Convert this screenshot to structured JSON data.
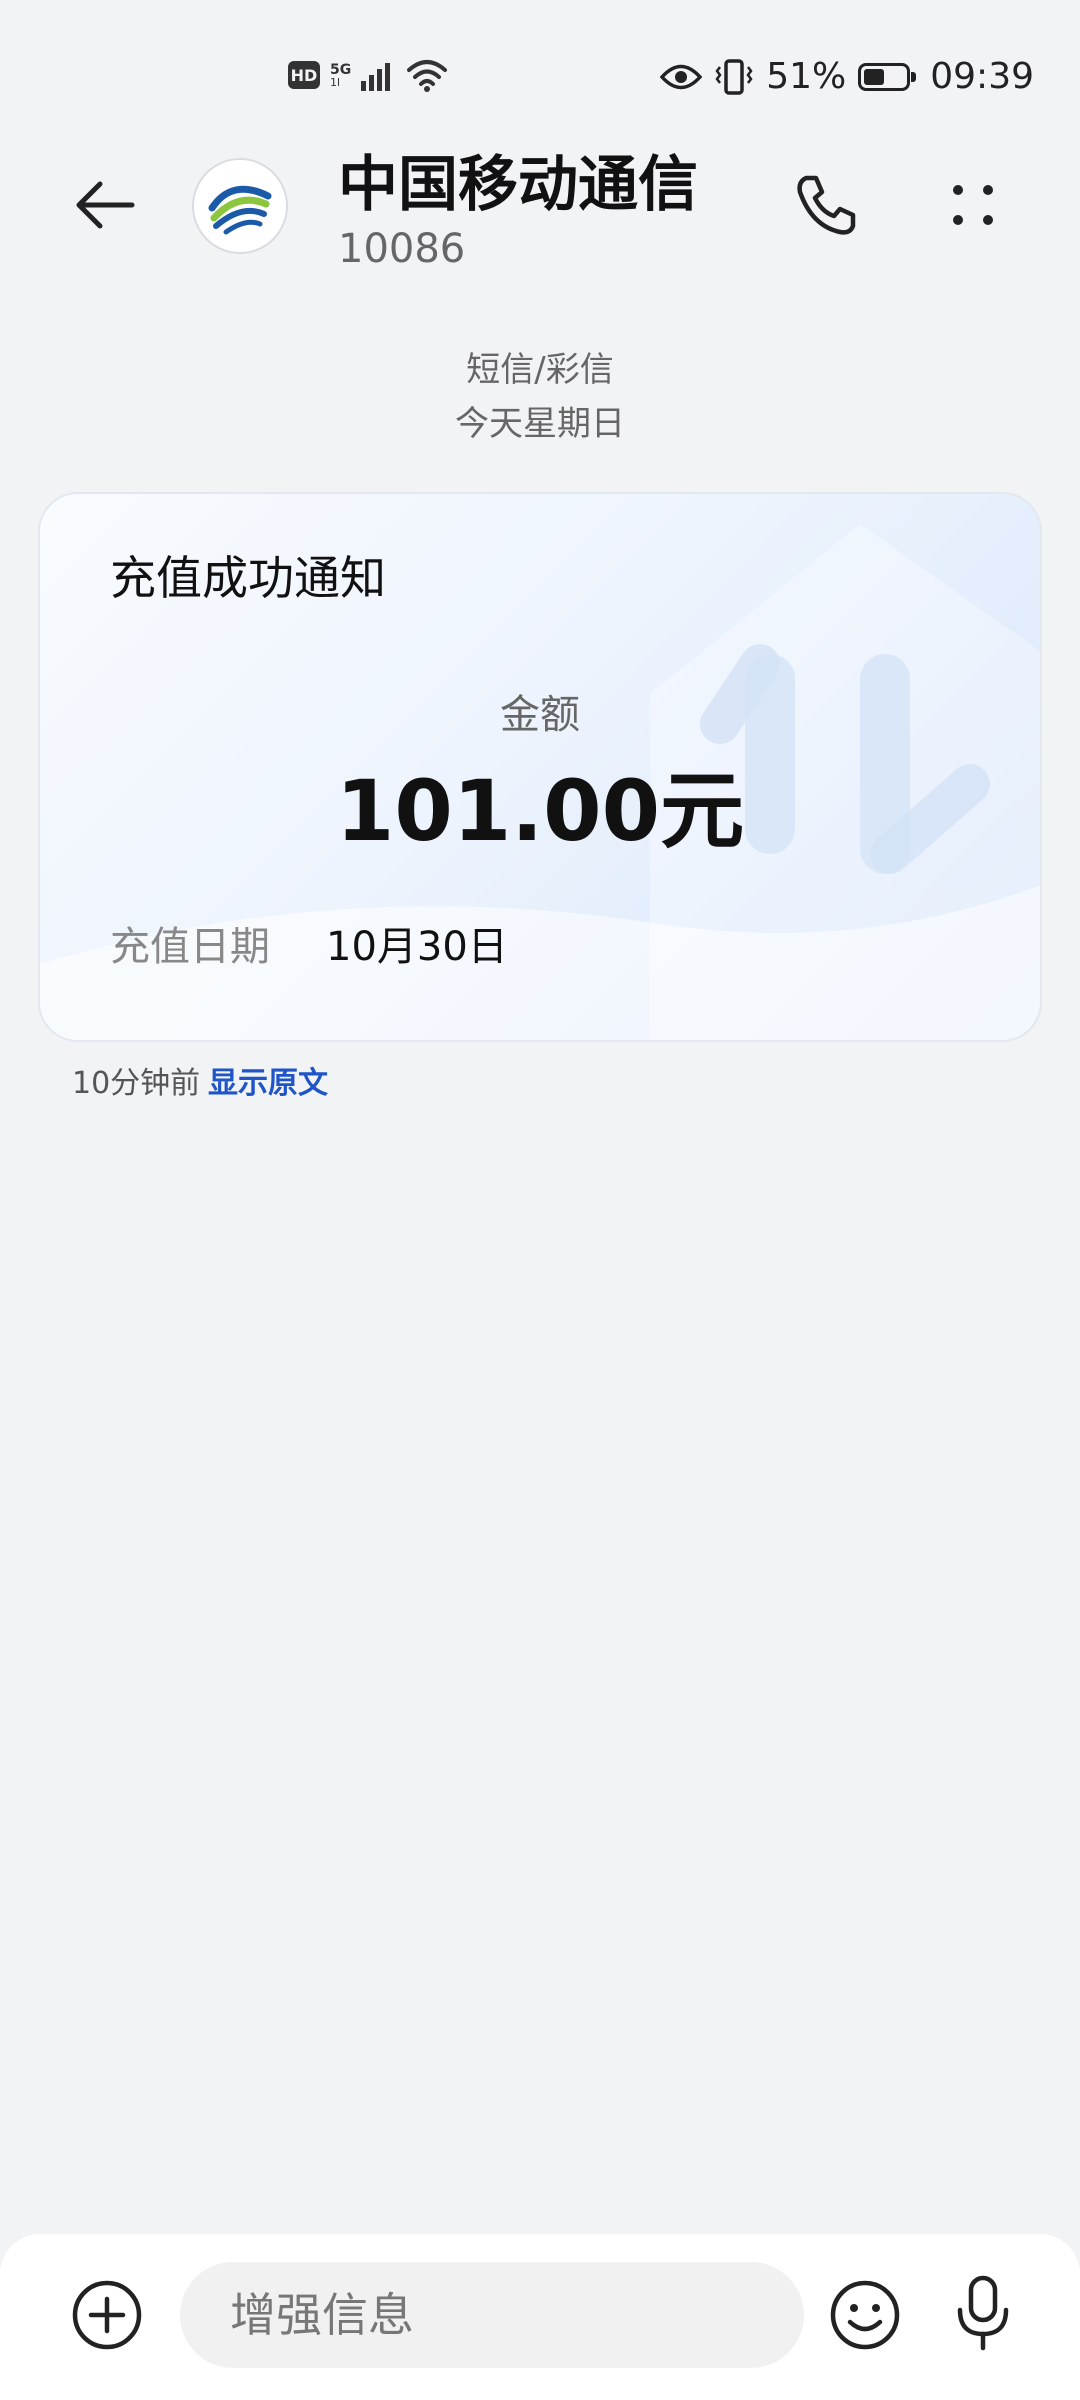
{
  "status_bar": {
    "hd": "HD",
    "network": "5G",
    "network_sub": "1l",
    "battery_percent": "51%",
    "battery_level": 0.51,
    "time": "09:39",
    "icons": [
      "hd-icon",
      "signal-icon",
      "wifi-icon",
      "eye-icon",
      "vibrate-icon",
      "battery-icon"
    ]
  },
  "header": {
    "contact_name": "中国移动通信",
    "contact_number": "10086",
    "icons": [
      "back-arrow-icon",
      "china-mobile-logo",
      "phone-icon",
      "more-dots-icon"
    ]
  },
  "thread": {
    "message_type": "短信/彩信",
    "date": "今天星期日"
  },
  "card": {
    "title": "充值成功通知",
    "amount_label": "金额",
    "amount_value": "101.00元",
    "date_label": "充值日期",
    "date_value": "10月30日"
  },
  "meta": {
    "time_ago": "10分钟前",
    "show_original": "显示原文"
  },
  "input_bar": {
    "placeholder": "增强信息",
    "icons": [
      "add-circle-icon",
      "emoji-icon",
      "microphone-icon"
    ]
  },
  "colors": {
    "background": "#f1f3f5",
    "link": "#1f55c8",
    "card_gradient_end": "#d6e5fb"
  }
}
